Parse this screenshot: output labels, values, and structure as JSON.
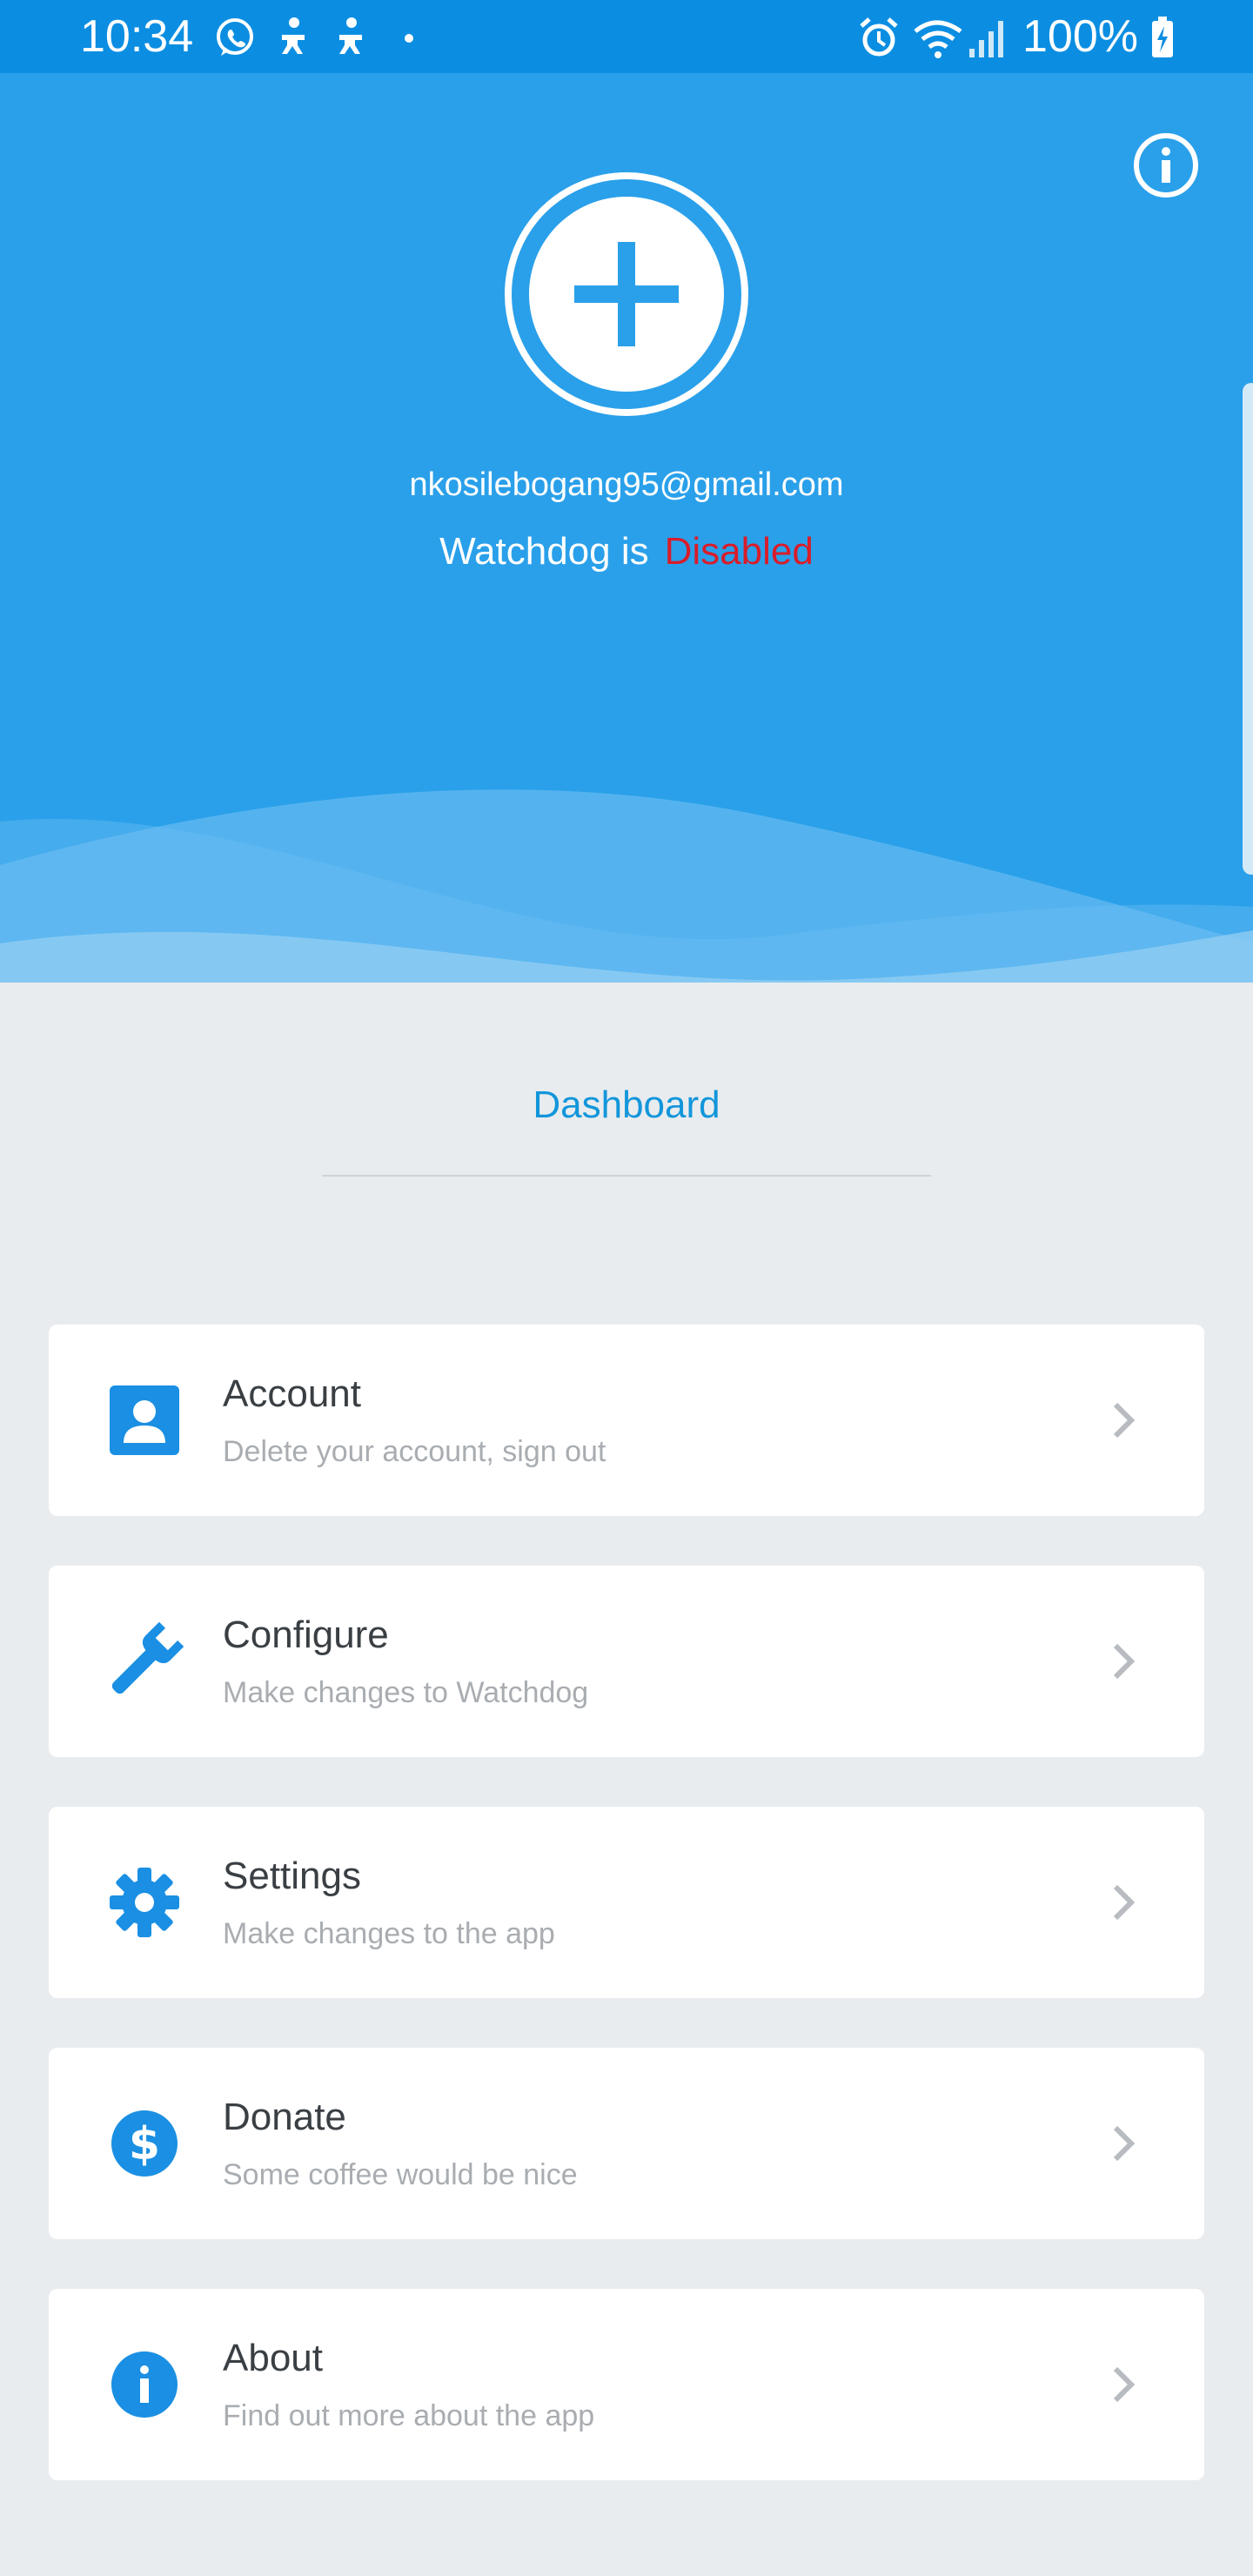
{
  "status_bar": {
    "time": "10:34",
    "battery": "100%",
    "icons": [
      "whatsapp-icon",
      "notification-icon",
      "notification-icon",
      "dot-icon",
      "alarm-icon",
      "wifi-icon",
      "signal-icon",
      "battery-charging-icon"
    ]
  },
  "header": {
    "email": "nkosilebogang95@gmail.com",
    "status_prefix": "Watchdog is",
    "status_value": "Disabled",
    "colors": {
      "background": "#2aa0ea",
      "status_disabled": "#d81d2b"
    }
  },
  "dashboard": {
    "title": "Dashboard",
    "accent": "#1296db"
  },
  "menu": {
    "items": [
      {
        "title": "Account",
        "subtitle": "Delete your account, sign out",
        "icon": "account-box-icon"
      },
      {
        "title": "Configure",
        "subtitle": "Make changes to Watchdog",
        "icon": "wrench-icon"
      },
      {
        "title": "Settings",
        "subtitle": "Make changes to the app",
        "icon": "gear-icon"
      },
      {
        "title": "Donate",
        "subtitle": "Some coffee would be nice",
        "icon": "dollar-circle-icon"
      },
      {
        "title": "About",
        "subtitle": "Find out more about the app",
        "icon": "info-circle-icon"
      }
    ]
  }
}
